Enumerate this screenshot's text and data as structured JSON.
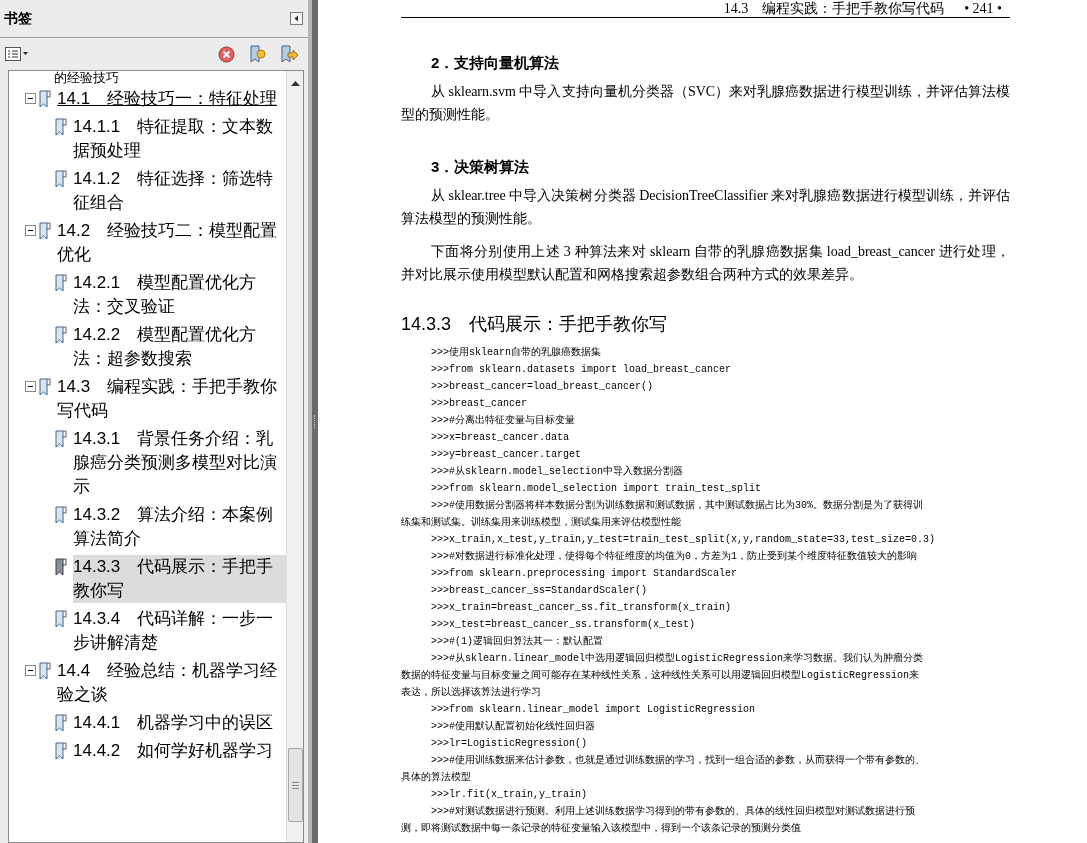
{
  "bookmarks_panel": {
    "title": "书签",
    "cut_text_at_top": "的经验技巧",
    "items": [
      {
        "label": "14.1　经验技巧一：特征处理",
        "expanded": true,
        "hovered": true,
        "selected": false,
        "children": [
          {
            "label": "14.1.1　特征提取：文本数据预处理",
            "hovered": false,
            "selected": false
          },
          {
            "label": "14.1.2　特征选择：筛选特征组合",
            "hovered": false,
            "selected": false
          }
        ]
      },
      {
        "label": "14.2　经验技巧二：模型配置优化",
        "expanded": true,
        "hovered": false,
        "selected": false,
        "children": [
          {
            "label": "14.2.1　模型配置优化方法：交叉验证",
            "hovered": false,
            "selected": false
          },
          {
            "label": "14.2.2　模型配置优化方法：超参数搜索",
            "hovered": false,
            "selected": false
          }
        ]
      },
      {
        "label": "14.3　编程实践：手把手教你写代码",
        "expanded": true,
        "hovered": false,
        "selected": false,
        "children": [
          {
            "label": "14.3.1　背景任务介绍：乳腺癌分类预测多模型对比演示",
            "hovered": false,
            "selected": false
          },
          {
            "label": "14.3.2　算法介绍：本案例算法简介",
            "hovered": false,
            "selected": false
          },
          {
            "label": "14.3.3　代码展示：手把手教你写",
            "hovered": false,
            "selected": true
          },
          {
            "label": "14.3.4　代码详解：一步一步讲解清楚",
            "hovered": false,
            "selected": false
          }
        ]
      },
      {
        "label": "14.4　经验总结：机器学习经验之谈",
        "expanded": true,
        "hovered": false,
        "selected": false,
        "children": [
          {
            "label": "14.4.1　机器学习中的误区",
            "hovered": false,
            "selected": false
          },
          {
            "label": "14.4.2　如何学好机器学习",
            "hovered": false,
            "selected": false
          }
        ]
      }
    ]
  },
  "page": {
    "running_head": "14.3　编程实践：手把手教你写代码",
    "page_number": "• 241 •",
    "blocks": [
      {
        "kind": "subheading",
        "text": "2．支持向量机算法"
      },
      {
        "kind": "paragraph",
        "text": "从 sklearn.svm 中导入支持向量机分类器（SVC）来对乳腺癌数据进行模型训练，并评估算法模型的预测性能。"
      },
      {
        "kind": "subheading",
        "text": "3．决策树算法"
      },
      {
        "kind": "paragraph",
        "text": "从 sklear.tree 中导入决策树分类器 DecisionTreeClassifier 来对乳腺癌数据进行模型训练，并评估算法模型的预测性能。"
      },
      {
        "kind": "paragraph",
        "text": "下面将分别使用上述 3 种算法来对 sklearn 自带的乳腺癌数据集 load_breast_cancer 进行处理，并对比展示使用模型默认配置和网格搜索超参数组合两种方式的效果差异。"
      },
      {
        "kind": "heading",
        "text": "14.3.3　代码展示：手把手教你写"
      },
      {
        "kind": "code",
        "lines": [
          ">>>使用sklearn自带的乳腺癌数据集"
        ]
      },
      {
        "kind": "code",
        "lines": [
          ">>>from sklearn.datasets import load_breast_cancer"
        ]
      },
      {
        "kind": "code",
        "lines": [
          ">>>breast_cancer=load_breast_cancer()"
        ]
      },
      {
        "kind": "code",
        "lines": [
          ">>>breast_cancer"
        ]
      },
      {
        "kind": "code",
        "lines": [
          ">>>#分离出特征变量与目标变量"
        ]
      },
      {
        "kind": "code",
        "lines": [
          ">>>x=breast_cancer.data"
        ]
      },
      {
        "kind": "code",
        "lines": [
          ">>>y=breast_cancer.target"
        ]
      },
      {
        "kind": "code",
        "lines": [
          ">>>#从sklearn.model_selection中导入数据分割器"
        ]
      },
      {
        "kind": "code",
        "lines": [
          ">>>from sklearn.model_selection import train_test_split"
        ]
      },
      {
        "kind": "code",
        "lines": [
          ">>>#使用数据分割器将样本数据分割为训练数据和测试数据，其中测试数据占比为30%。数据分割是为了获得训",
          "练集和测试集。训练集用来训练模型，测试集用来评估模型性能"
        ]
      },
      {
        "kind": "code",
        "lines": [
          ">>>x_train,x_test,y_train,y_test=train_test_split(x,y,random_state=33,test_size=0.3)"
        ]
      },
      {
        "kind": "code",
        "lines": [
          ">>>#对数据进行标准化处理，使得每个特征维度的均值为0，方差为1，防止受到某个维度特征数值较大的影响"
        ]
      },
      {
        "kind": "code",
        "lines": [
          ">>>from sklearn.preprocessing import StandardScaler"
        ]
      },
      {
        "kind": "code",
        "lines": [
          ">>>breast_cancer_ss=StandardScaler()"
        ]
      },
      {
        "kind": "code",
        "lines": [
          ">>>x_train=breast_cancer_ss.fit_transform(x_train)"
        ]
      },
      {
        "kind": "code",
        "lines": [
          ">>>x_test=breast_cancer_ss.transform(x_test)"
        ]
      },
      {
        "kind": "code",
        "lines": [
          ">>>#(1)逻辑回归算法其一：默认配置"
        ]
      },
      {
        "kind": "code",
        "lines": [
          ">>>#从sklearn.linear_model中选用逻辑回归模型LogisticRegression来学习数据。我们认为肿瘤分类",
          "数据的特征变量与目标变量之间可能存在某种线性关系，这种线性关系可以用逻辑回归模型LogisticRegression来",
          "表达，所以选择该算法进行学习"
        ]
      },
      {
        "kind": "code",
        "lines": [
          ">>>from sklearn.linear_model import LogisticRegression"
        ]
      },
      {
        "kind": "code",
        "lines": [
          ">>>#使用默认配置初始化线性回归器"
        ]
      },
      {
        "kind": "code",
        "lines": [
          ">>>lr=LogisticRegression()"
        ]
      },
      {
        "kind": "code",
        "lines": [
          ">>>#使用训练数据来估计参数，也就是通过训练数据的学习，找到一组合适的参数，从而获得一个带有参数的、",
          "具体的算法模型"
        ]
      },
      {
        "kind": "code",
        "lines": [
          ">>>lr.fit(x_train,y_train)"
        ]
      },
      {
        "kind": "code",
        "lines": [
          ">>>#对测试数据进行预测。利用上述训练数据学习得到的带有参数的、具体的线性回归模型对测试数据进行预",
          "测，即将测试数据中每一条记录的特征变量输入该模型中，得到一个该条记录的预测分类值"
        ]
      }
    ]
  }
}
